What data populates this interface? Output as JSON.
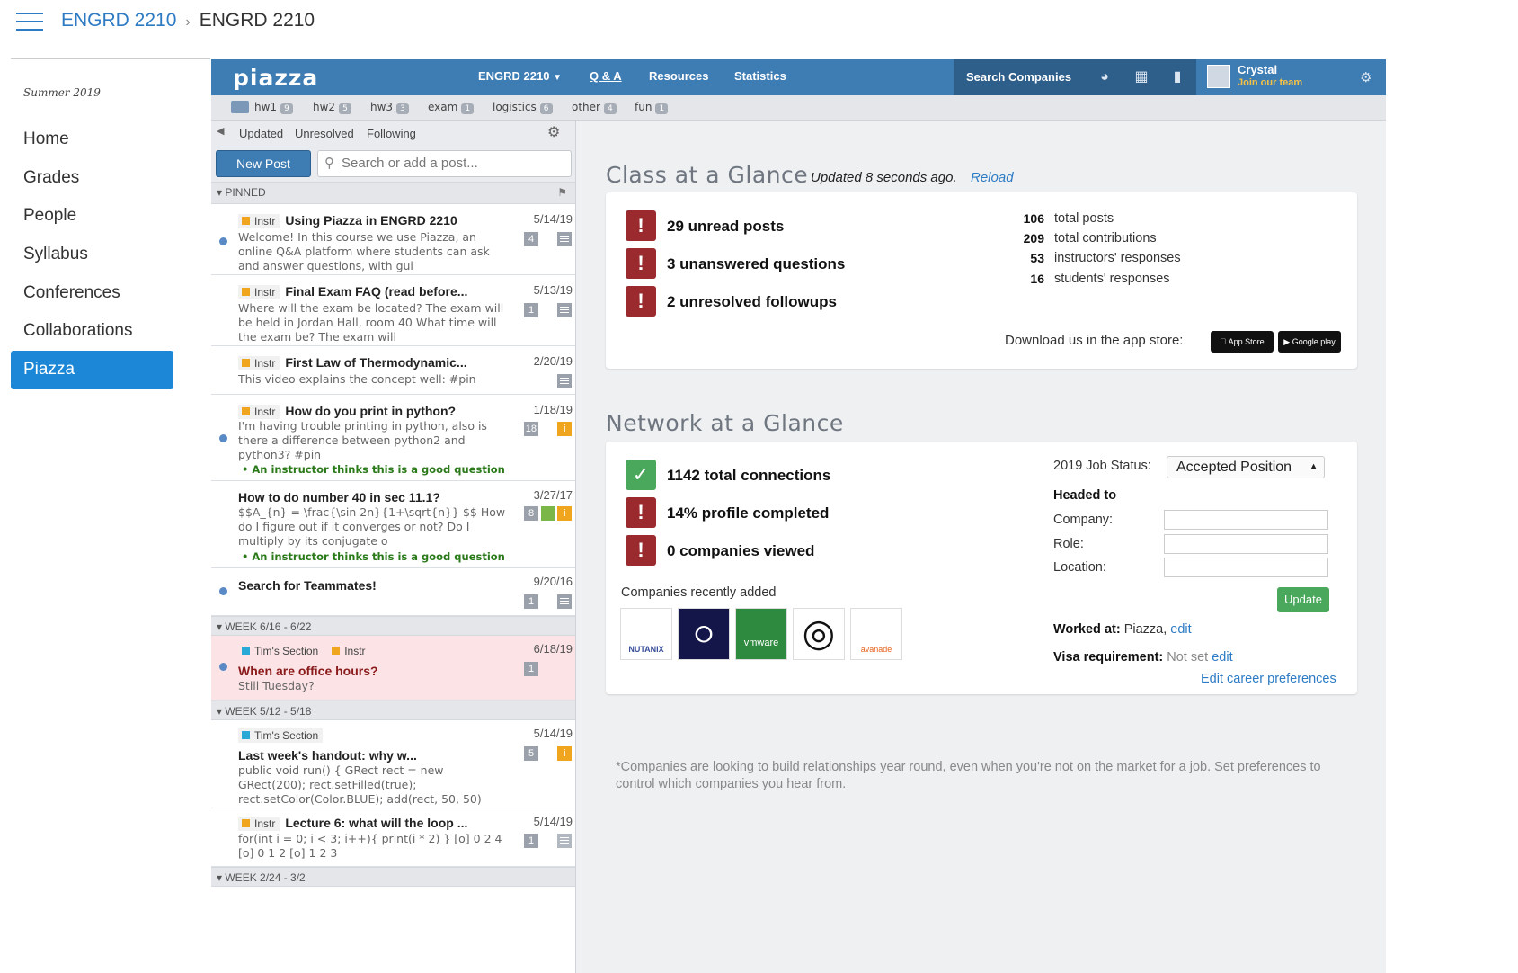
{
  "canvas": {
    "breadcrumb": [
      "ENGRD 2210",
      "ENGRD 2210"
    ],
    "term": "Summer 2019",
    "nav": [
      "Home",
      "Grades",
      "People",
      "Syllabus",
      "Conferences",
      "Collaborations",
      "Piazza"
    ],
    "active_nav": "Piazza"
  },
  "piazza": {
    "logo": "piazza",
    "course": "ENGRD 2210",
    "tabs": [
      "Q & A",
      "Resources",
      "Statistics"
    ],
    "search_companies": "Search Companies",
    "user_name": "Crystal",
    "join_team": "Join our team",
    "folders": [
      {
        "name": "hw1",
        "count": "9"
      },
      {
        "name": "hw2",
        "count": "5"
      },
      {
        "name": "hw3",
        "count": "3"
      },
      {
        "name": "exam",
        "count": "1"
      },
      {
        "name": "logistics",
        "count": "6"
      },
      {
        "name": "other",
        "count": "4"
      },
      {
        "name": "fun",
        "count": "1"
      }
    ],
    "colors": {
      "bar": "#3e7cb4",
      "alert": "#9a2a2e",
      "check": "#4aa85c",
      "link": "#2d7bc4",
      "canvas_active": "#1b87d6"
    }
  },
  "feed": {
    "filters": [
      "Updated",
      "Unresolved",
      "Following"
    ],
    "new_post": "New Post",
    "search_placeholder": "Search or add a post...",
    "groups": [
      "PINNED",
      "WEEK 6/16 - 6/22",
      "WEEK 5/12 - 5/18",
      "WEEK 2/24 - 3/2"
    ],
    "good_question": "An instructor thinks this is a good question",
    "posts": [
      {
        "tags": [
          "Instr"
        ],
        "title": "Using Piazza in ENGRD 2210",
        "body": "Welcome! In this course we use Piazza, an online Q&A platform where students can ask and answer questions, with gui",
        "date": "5/14/19",
        "count": "4",
        "unread": true
      },
      {
        "tags": [
          "Instr"
        ],
        "title": "Final Exam FAQ (read before...",
        "body": "Where will the exam be located? The exam will be held in Jordan Hall, room 40 What time will the exam be? The exam will",
        "date": "5/13/19",
        "count": "1",
        "unread": false
      },
      {
        "tags": [
          "Instr"
        ],
        "title": "First Law of Thermodynamic...",
        "body": "This video explains the concept well: #pin",
        "date": "2/20/19",
        "count": "",
        "unread": false
      },
      {
        "tags": [
          "Instr"
        ],
        "title": "How do you print in python?",
        "body": "I'm having trouble printing in python, also is there a difference between python2 and python3? #pin",
        "date": "1/18/19",
        "count": "18",
        "unread": true
      },
      {
        "tags": [],
        "title": "How to do number 40 in sec 11.1?",
        "body": "$$A_{n} = \\frac{\\sin 2n}{1+\\sqrt{n}} $$ How do I figure out if it converges or not? Do I multiply by its conjugate o",
        "date": "3/27/17",
        "count": "8",
        "unread": false
      },
      {
        "tags": [],
        "title": "Search for Teammates!",
        "body": "",
        "date": "9/20/16",
        "count": "1",
        "unread": true
      },
      {
        "tags": [
          "Tim's Section",
          "Instr"
        ],
        "title": "When are office hours?",
        "body": "Still Tuesday?",
        "date": "6/18/19",
        "count": "1",
        "unread": true
      },
      {
        "tags": [
          "Tim's Section"
        ],
        "title": "Last week's handout: why w...",
        "body": "public void run() { GRect rect = new GRect(200); rect.setFilled(true); rect.setColor(Color.BLUE); add(rect, 50, 50)",
        "date": "5/14/19",
        "count": "5",
        "unread": false
      },
      {
        "tags": [
          "Instr"
        ],
        "title": "Lecture 6: what will the loop ...",
        "body": "for(int i = 0; i < 3; i++){ print(i * 2) } [o] 0 2 4 [o] 0 1 2 [o] 1 2 3",
        "date": "5/14/19",
        "count": "1",
        "unread": false
      }
    ]
  },
  "class_glance": {
    "heading": "Class at a Glance",
    "updated": "Updated   8 seconds ago.",
    "reload": "Reload",
    "alerts": [
      "29 unread posts",
      "3 unanswered questions",
      "2 unresolved followups"
    ],
    "stats": [
      {
        "num": "106",
        "label": "total posts"
      },
      {
        "num": "209",
        "label": "total contributions"
      },
      {
        "num": "53",
        "label": "instructors' responses"
      },
      {
        "num": "16",
        "label": "students' responses"
      }
    ],
    "download": "Download us in the app store:",
    "app_store": "App Store",
    "google_play": "Google play"
  },
  "network_glance": {
    "heading": "Network at a Glance",
    "items": [
      "1142 total connections",
      "14% profile completed",
      "0 companies viewed"
    ],
    "recently_added": "Companies recently added",
    "companies": [
      "NUTANIX",
      "",
      "vmware",
      "",
      "avanade"
    ],
    "job_status_label": "2019 Job Status:",
    "job_status": "Accepted Position",
    "headed_to": "Headed to",
    "company_label": "Company:",
    "role_label": "Role:",
    "location_label": "Location:",
    "update": "Update",
    "worked_at_label": "Worked at:",
    "worked_at": "Piazza,",
    "edit": "edit",
    "visa_label": "Visa requirement:",
    "visa_value": "Not set",
    "edit_career": "Edit career preferences",
    "footnote": "*Companies are looking to build relationships year round, even when you're not on the market for a job. Set preferences to control which companies you hear from."
  }
}
